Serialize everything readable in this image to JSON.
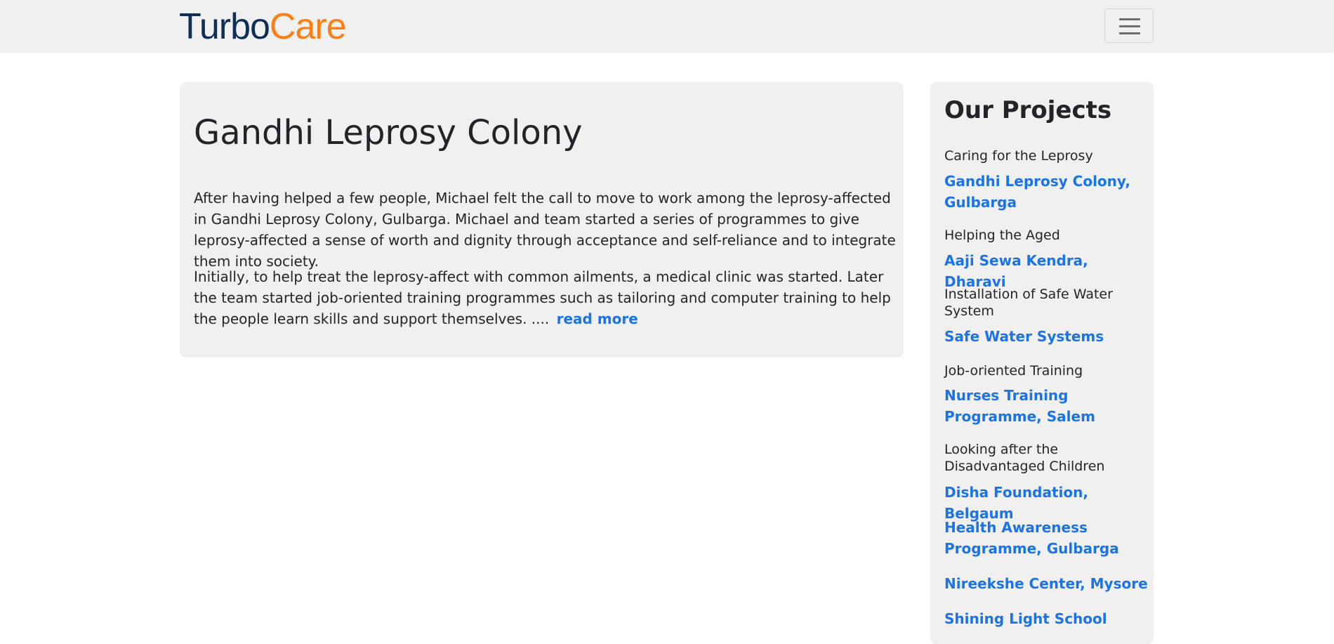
{
  "brand": {
    "part1": "Turbo",
    "part2": "Care",
    "color_dark": "#0f2f55",
    "color_accent": "#fd7e14"
  },
  "nav": {
    "toggler_icon": "hamburger-menu-icon"
  },
  "main": {
    "title": "Gandhi Leprosy Colony",
    "paragraph1": "After having helped a few people, Michael felt the call to move to work among the leprosy-affected in Gandhi Leprosy Colony, Gulbarga. Michael and team started a series of programmes to give leprosy-affected a sense of worth and dignity through acceptance and self-reliance and to integrate them into society.",
    "paragraph2": "Initially, to help treat the leprosy-affect with common ailments, a medical clinic was started. Later the team started job-oriented training programmes such as tailoring and computer training to help the people learn skills and support themselves. ....",
    "read_more": "read more"
  },
  "sidebar": {
    "title": "Our Projects",
    "items": [
      {
        "category": "Caring for the Leprosy",
        "link": "Gandhi Leprosy Colony, Gulbarga"
      },
      {
        "category": "Helping the Aged",
        "link": "Aaji Sewa Kendra, Dharavi"
      },
      {
        "category": "Installation of Safe Water System",
        "link": "Safe Water Systems"
      },
      {
        "category": "Job-oriented Training",
        "link": "Nurses Training Programme, Salem"
      },
      {
        "category": "Looking after the Disadvantaged Children",
        "link": "Disha Foundation, Belgaum"
      },
      {
        "category": "",
        "link": "Health Awareness Programme, Gulbarga"
      },
      {
        "category": "",
        "link": "Nireekshe Center, Mysore"
      },
      {
        "category": "",
        "link": "Shining Light School"
      }
    ]
  },
  "colors": {
    "link": "#1a73e8",
    "panel_bg": "#f0f0f0",
    "text": "#212529"
  }
}
